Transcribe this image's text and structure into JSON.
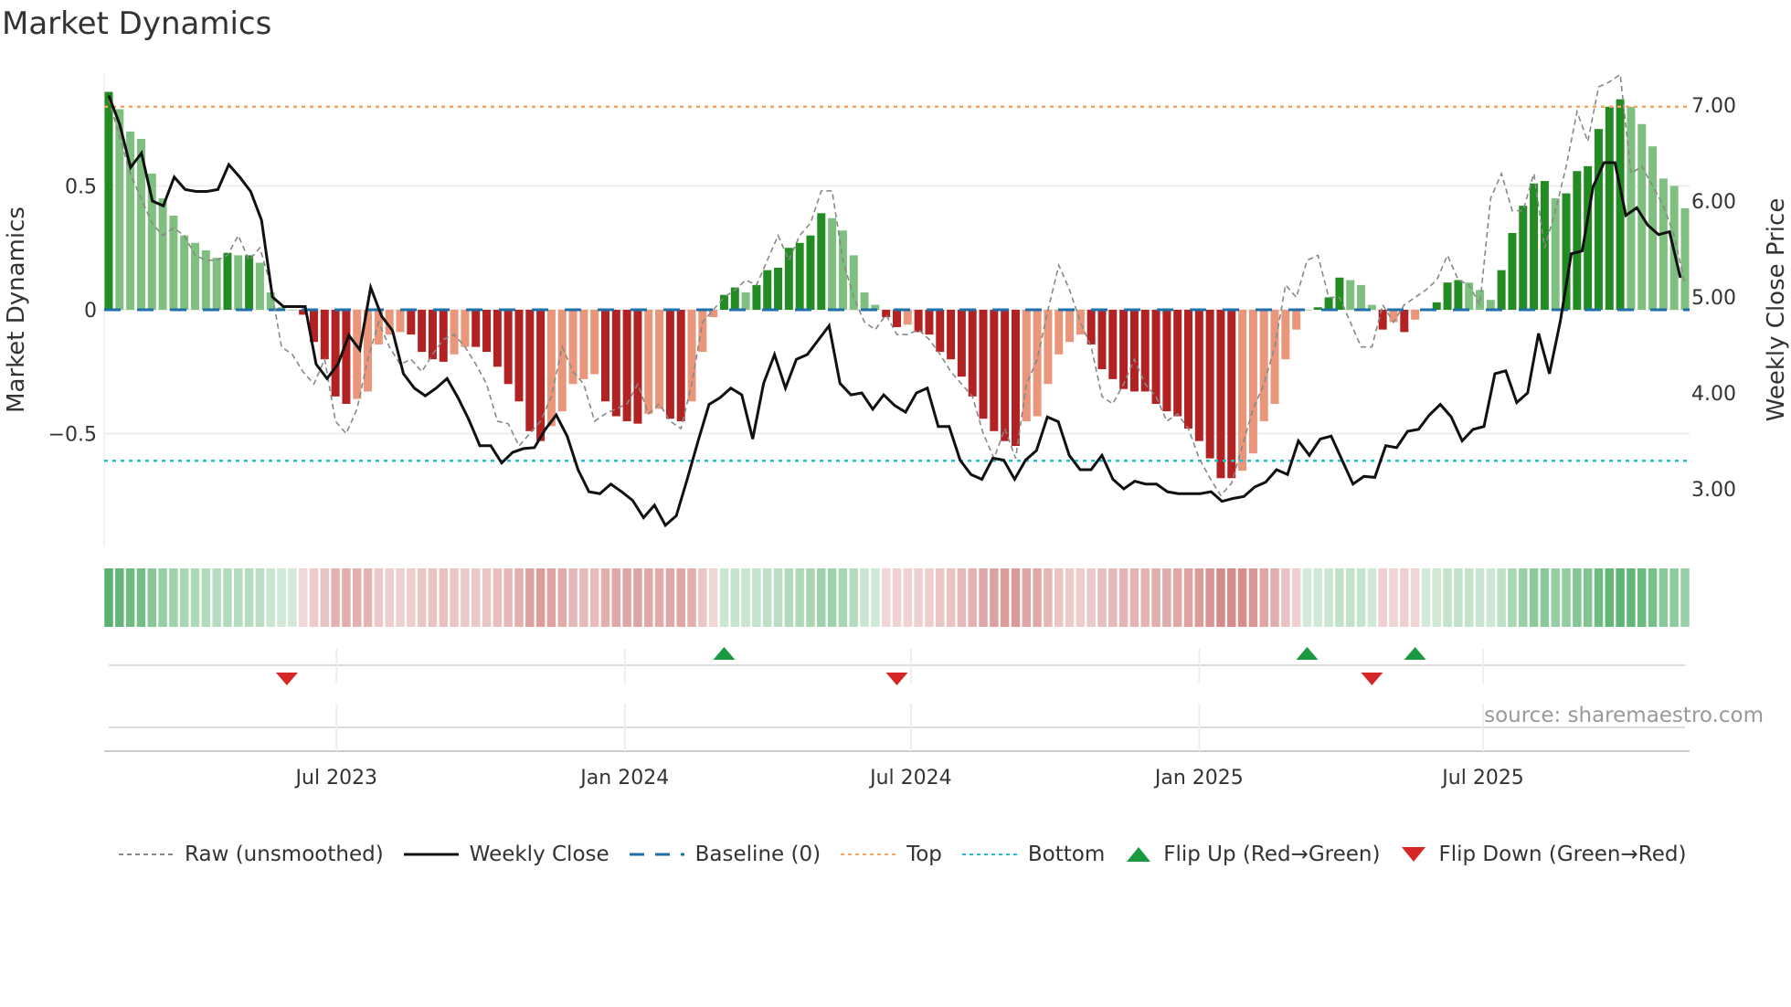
{
  "title": "Market Dynamics",
  "source": "source: sharemaestro.com",
  "colors": {
    "up_strong": "#228B22",
    "up_weak": "#7fbf7f",
    "down_strong": "#b22222",
    "down_weak": "#e9967a",
    "top": "#f4a460",
    "bottom": "#20c0d0",
    "baseline": "#1f6fa8",
    "close": "#111111",
    "raw": "#888888",
    "flip_up": "#1a9a40",
    "flip_down": "#d62728"
  },
  "chart_data": {
    "type": "bar",
    "title": "Market Dynamics",
    "ylabel": "Market Dynamics",
    "y2label": "Weekly Close Price",
    "ylim": [
      -0.96,
      0.93
    ],
    "y2lim": [
      2.5,
      7.25
    ],
    "yticks": [
      {
        "v": 0.5,
        "label": "0.5"
      },
      {
        "v": 0,
        "label": "0"
      },
      {
        "v": -0.5,
        "label": "−0.5"
      }
    ],
    "y2ticks": [
      {
        "v": 7,
        "label": "7.00"
      },
      {
        "v": 6,
        "label": "6.00"
      },
      {
        "v": 5,
        "label": "5.00"
      },
      {
        "v": 4,
        "label": "4.00"
      },
      {
        "v": 3,
        "label": "3.00"
      }
    ],
    "xticks": [
      {
        "week": 21.1,
        "label": "Jul 2023"
      },
      {
        "week": 47.8,
        "label": "Jan 2024"
      },
      {
        "week": 74.3,
        "label": "Jul 2024"
      },
      {
        "week": 101,
        "label": "Jan 2025"
      },
      {
        "week": 127.3,
        "label": "Jul 2025"
      }
    ],
    "top": 0.82,
    "bottom": -0.61,
    "baseline": 0,
    "momentum": [
      0.88,
      0.81,
      0.72,
      0.69,
      0.55,
      0.45,
      0.38,
      0.3,
      0.27,
      0.24,
      0.21,
      0.23,
      0.22,
      0.22,
      0.19,
      0.07,
      0.01,
      0,
      -0.02,
      -0.13,
      -0.2,
      -0.35,
      -0.38,
      -0.36,
      -0.33,
      -0.14,
      -0.1,
      -0.09,
      -0.1,
      -0.17,
      -0.2,
      -0.21,
      -0.18,
      -0.15,
      -0.15,
      -0.17,
      -0.23,
      -0.3,
      -0.37,
      -0.49,
      -0.53,
      -0.47,
      -0.41,
      -0.3,
      -0.28,
      -0.26,
      -0.37,
      -0.43,
      -0.45,
      -0.46,
      -0.42,
      -0.4,
      -0.44,
      -0.45,
      -0.37,
      -0.17,
      -0.03,
      0.06,
      0.09,
      0.07,
      0.1,
      0.16,
      0.17,
      0.25,
      0.27,
      0.3,
      0.39,
      0.37,
      0.32,
      0.22,
      0.07,
      0.02,
      -0.03,
      -0.07,
      -0.06,
      -0.09,
      -0.1,
      -0.17,
      -0.2,
      -0.27,
      -0.35,
      -0.44,
      -0.49,
      -0.53,
      -0.55,
      -0.45,
      -0.43,
      -0.3,
      -0.18,
      -0.13,
      -0.1,
      -0.14,
      -0.24,
      -0.28,
      -0.32,
      -0.33,
      -0.33,
      -0.38,
      -0.41,
      -0.43,
      -0.48,
      -0.53,
      -0.6,
      -0.68,
      -0.68,
      -0.65,
      -0.58,
      -0.45,
      -0.38,
      -0.2,
      -0.08,
      0,
      0.01,
      0.05,
      0.13,
      0.12,
      0.1,
      0.02,
      -0.08,
      -0.05,
      -0.09,
      -0.04,
      0,
      0.03,
      0.11,
      0.12,
      0.11,
      0.08,
      0.04,
      0.16,
      0.31,
      0.42,
      0.51,
      0.52,
      0.45,
      0.47,
      0.56,
      0.58,
      0.73,
      0.82,
      0.85,
      0.82,
      0.75,
      0.66,
      0.53,
      0.5,
      0.41
    ],
    "raw": [
      0.85,
      0.7,
      0.55,
      0.45,
      0.35,
      0.3,
      0.33,
      0.3,
      0.22,
      0.2,
      0.2,
      0.22,
      0.3,
      0.2,
      0.25,
      0.1,
      -0.15,
      -0.18,
      -0.25,
      -0.3,
      -0.2,
      -0.45,
      -0.5,
      -0.4,
      -0.2,
      -0.05,
      -0.15,
      -0.22,
      -0.2,
      -0.25,
      -0.18,
      -0.12,
      -0.1,
      -0.15,
      -0.22,
      -0.3,
      -0.45,
      -0.46,
      -0.55,
      -0.5,
      -0.45,
      -0.35,
      -0.15,
      -0.25,
      -0.3,
      -0.45,
      -0.42,
      -0.4,
      -0.38,
      -0.3,
      -0.42,
      -0.38,
      -0.45,
      -0.48,
      -0.3,
      -0.05,
      0,
      0.05,
      0.08,
      0.12,
      0.1,
      0.2,
      0.3,
      0.2,
      0.3,
      0.35,
      0.48,
      0.48,
      0.2,
      0.05,
      -0.05,
      -0.08,
      -0.02,
      -0.1,
      -0.1,
      -0.08,
      -0.12,
      -0.18,
      -0.25,
      -0.3,
      -0.35,
      -0.5,
      -0.6,
      -0.48,
      -0.6,
      -0.3,
      -0.2,
      0,
      0.18,
      0.08,
      -0.05,
      -0.15,
      -0.35,
      -0.38,
      -0.3,
      -0.2,
      -0.3,
      -0.35,
      -0.45,
      -0.42,
      -0.48,
      -0.6,
      -0.68,
      -0.75,
      -0.7,
      -0.55,
      -0.4,
      -0.3,
      -0.15,
      0.1,
      0.05,
      0.2,
      0.22,
      0.05,
      0.05,
      -0.05,
      -0.15,
      -0.15,
      0.02,
      -0.05,
      0.02,
      0.05,
      0.08,
      0.12,
      0.22,
      0.12,
      0.1,
      0.02,
      0.45,
      0.55,
      0.4,
      0.4,
      0.55,
      0.25,
      0.4,
      0.58,
      0.8,
      0.68,
      0.9,
      0.92,
      0.95,
      0.55,
      0.58,
      0.5,
      0.42,
      0.3,
      0.1
    ],
    "close": [
      7.1,
      6.8,
      6.35,
      6.5,
      6.0,
      5.95,
      6.25,
      6.12,
      6.1,
      6.1,
      6.12,
      6.38,
      6.25,
      6.1,
      5.8,
      5.0,
      4.9,
      4.9,
      4.9,
      4.3,
      4.15,
      4.3,
      4.6,
      4.45,
      5.1,
      4.8,
      4.65,
      4.2,
      4.05,
      3.97,
      4.05,
      4.15,
      3.95,
      3.72,
      3.45,
      3.45,
      3.27,
      3.38,
      3.42,
      3.43,
      3.62,
      3.77,
      3.55,
      3.2,
      2.97,
      2.95,
      3.05,
      2.97,
      2.88,
      2.7,
      2.83,
      2.62,
      2.72,
      3.1,
      3.5,
      3.88,
      3.95,
      4.05,
      3.98,
      3.52,
      4.1,
      4.4,
      4.05,
      4.35,
      4.4,
      4.55,
      4.7,
      4.1,
      3.98,
      4.0,
      3.83,
      3.98,
      3.87,
      3.8,
      4.0,
      4.05,
      3.65,
      3.65,
      3.3,
      3.15,
      3.1,
      3.32,
      3.3,
      3.1,
      3.3,
      3.4,
      3.75,
      3.7,
      3.35,
      3.2,
      3.2,
      3.35,
      3.1,
      3.0,
      3.08,
      3.05,
      3.05,
      2.97,
      2.95,
      2.95,
      2.95,
      2.97,
      2.87,
      2.9,
      2.92,
      3.02,
      3.07,
      3.2,
      3.15,
      3.5,
      3.35,
      3.52,
      3.55,
      3.3,
      3.05,
      3.13,
      3.12,
      3.45,
      3.43,
      3.6,
      3.62,
      3.77,
      3.88,
      3.75,
      3.5,
      3.62,
      3.65,
      4.2,
      4.23,
      3.9,
      4.0,
      4.62,
      4.2,
      4.75,
      5.45,
      5.48,
      6.15,
      6.4,
      6.4,
      5.85,
      5.93,
      5.75,
      5.65,
      5.68,
      5.2
    ],
    "flips": [
      {
        "type": "down",
        "week": 16.5
      },
      {
        "type": "up",
        "week": 57
      },
      {
        "type": "down",
        "week": 73
      },
      {
        "type": "up",
        "week": 111
      },
      {
        "type": "down",
        "week": 117
      },
      {
        "type": "up",
        "week": 121
      }
    ],
    "legend": [
      "Raw (unsmoothed)",
      "Weekly Close",
      "Baseline (0)",
      "Top",
      "Bottom",
      "Flip Up (Red→Green)",
      "Flip Down (Green→Red)"
    ]
  }
}
